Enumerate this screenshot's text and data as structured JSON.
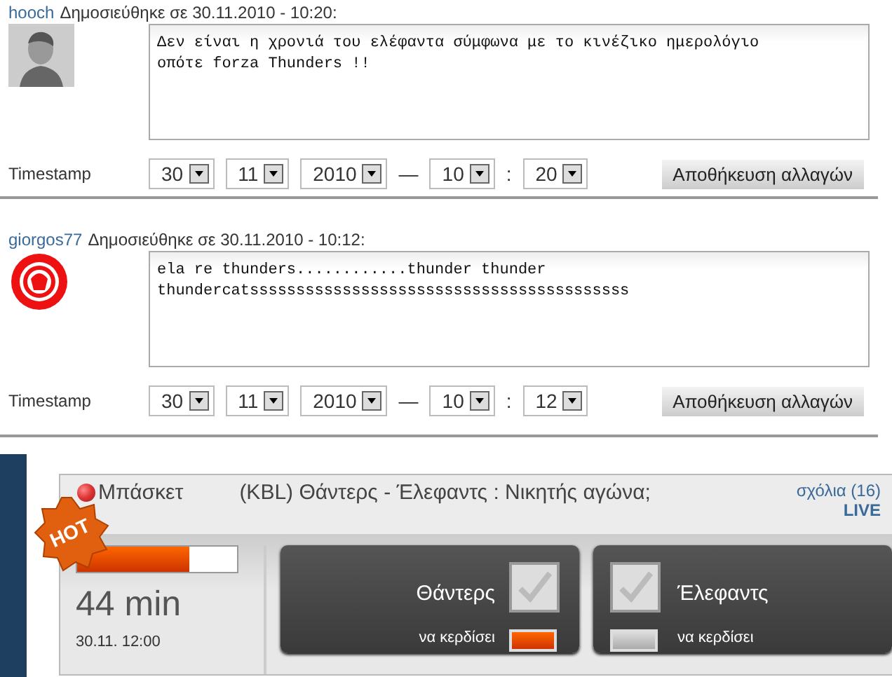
{
  "comments": [
    {
      "user": "hooch",
      "posted": "Δημοσιεύθηκε σε 30.11.2010 - 10:20:",
      "kind": "silhouette",
      "text": "Δεν είναι η χρονιά του ελέφαντα σύμφωνα με το κινέζικο ημερολόγιο\nοπότε forza Thunders !!",
      "timestamp_label": "Timestamp",
      "day": "30",
      "month": "11",
      "year": "2010",
      "dash": "—",
      "hour": "10",
      "colon": ":",
      "minute": "20",
      "save": "Αποθήκευση αλλαγών"
    },
    {
      "user": "giorgos77",
      "posted": "Δημοσιεύθηκε σε 30.11.2010 - 10:12:",
      "kind": "emblem",
      "text": "ela re thunders............thunder thunder\nthundercatsssssssssssssssssssssssssssssssssssssssss",
      "timestamp_label": "Timestamp",
      "day": "30",
      "month": "11",
      "year": "2010",
      "dash": "—",
      "hour": "10",
      "colon": ":",
      "minute": "12",
      "save": "Αποθήκευση αλλαγών"
    }
  ],
  "bet": {
    "badge": "HOT",
    "sport": "Μπάσκετ",
    "question": "(KBL) Θάντερς - Έλεφαντς : Νικητής αγώνα;",
    "comments_link": "σχόλια (16)",
    "live": "LIVE",
    "progress": {
      "level": 0.7
    },
    "elapsed": "44 min",
    "date": "30.11. 12:00",
    "options": [
      {
        "kind": "home",
        "team": "Θάντερς",
        "checked": false,
        "caption": "να κερδίσει",
        "highlighted": true
      },
      {
        "kind": "away",
        "team": "Έλεφαντς",
        "checked": false,
        "caption": "να κερδίσει",
        "highlighted": false
      }
    ]
  }
}
